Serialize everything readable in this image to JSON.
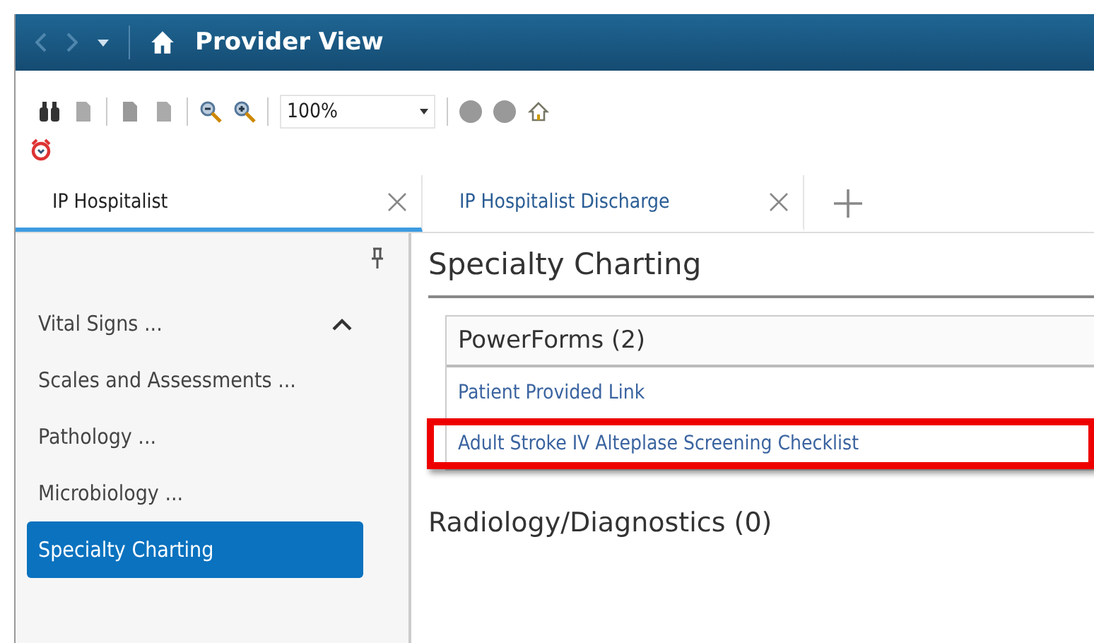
{
  "title_bar": {
    "title": "Provider View"
  },
  "toolbar": {
    "zoom": "100%"
  },
  "tabs": [
    {
      "label": "IP Hospitalist",
      "selected": true
    },
    {
      "label": "IP Hospitalist Discharge",
      "selected": false
    }
  ],
  "sidebar": {
    "items": [
      {
        "label": "Vital Signs ...",
        "selected": false
      },
      {
        "label": "Scales and Assessments ...",
        "selected": false
      },
      {
        "label": "Pathology ...",
        "selected": false
      },
      {
        "label": "Microbiology ...",
        "selected": false
      },
      {
        "label": "Specialty Charting",
        "selected": true
      }
    ]
  },
  "content": {
    "heading": "Specialty Charting",
    "sections": [
      {
        "title": "PowerForms (2)",
        "links": [
          {
            "label": "Patient Provided Link",
            "highlighted": false
          },
          {
            "label": "Adult Stroke IV Alteplase Screening Checklist",
            "highlighted": true
          }
        ]
      }
    ],
    "next_section": "Radiology/Diagnostics  (0)"
  }
}
